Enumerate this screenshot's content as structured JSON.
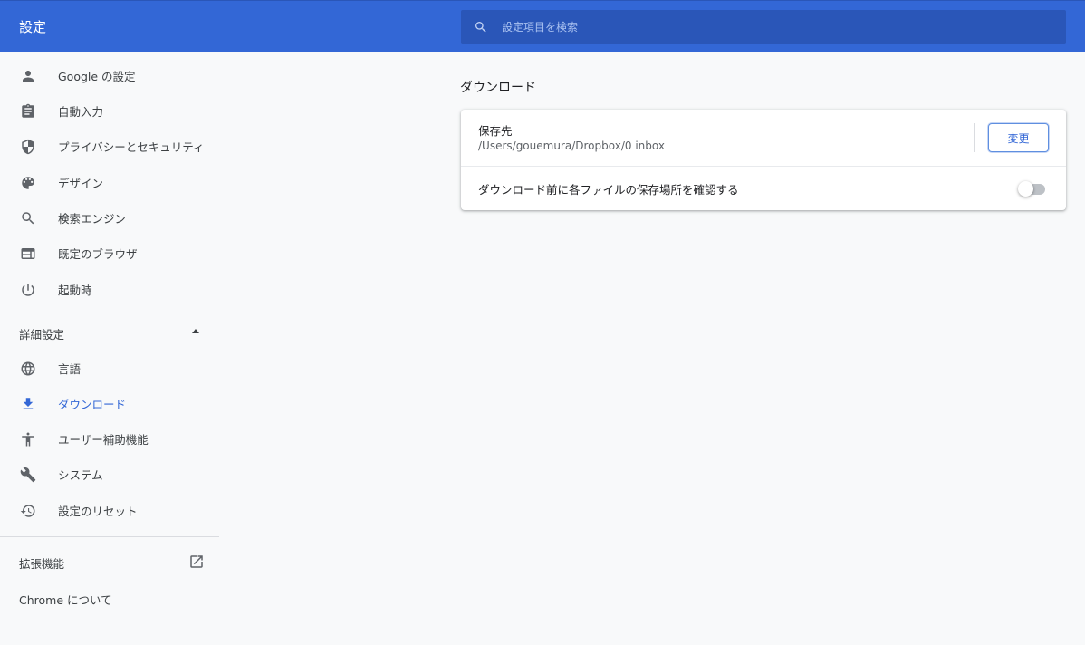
{
  "header": {
    "title": "設定",
    "search_placeholder": "設定項目を検索"
  },
  "sidebar": {
    "items": [
      {
        "label": "Google の設定",
        "icon": "person-icon"
      },
      {
        "label": "自動入力",
        "icon": "clipboard-icon"
      },
      {
        "label": "プライバシーとセキュリティ",
        "icon": "shield-icon"
      },
      {
        "label": "デザイン",
        "icon": "palette-icon"
      },
      {
        "label": "検索エンジン",
        "icon": "search-icon"
      },
      {
        "label": "既定のブラウザ",
        "icon": "browser-window-icon"
      },
      {
        "label": "起動時",
        "icon": "power-icon"
      }
    ],
    "advanced_label": "詳細設定",
    "advanced_items": [
      {
        "label": "言語",
        "icon": "globe-icon"
      },
      {
        "label": "ダウンロード",
        "icon": "download-icon",
        "active": true
      },
      {
        "label": "ユーザー補助機能",
        "icon": "accessibility-icon"
      },
      {
        "label": "システム",
        "icon": "wrench-icon"
      },
      {
        "label": "設定のリセット",
        "icon": "history-icon"
      }
    ],
    "extensions_label": "拡張機能",
    "about_label": "Chrome について"
  },
  "main": {
    "section_title": "ダウンロード",
    "location_label": "保存先",
    "location_path": "/Users/gouemura/Dropbox/0 inbox",
    "change_button": "変更",
    "ask_label": "ダウンロード前に各ファイルの保存場所を確認する",
    "ask_enabled": false
  },
  "colors": {
    "accent": "#3367d6",
    "header_bg": "#3367d6",
    "search_bg": "#2a56b8",
    "page_bg": "#f8f9fa"
  }
}
